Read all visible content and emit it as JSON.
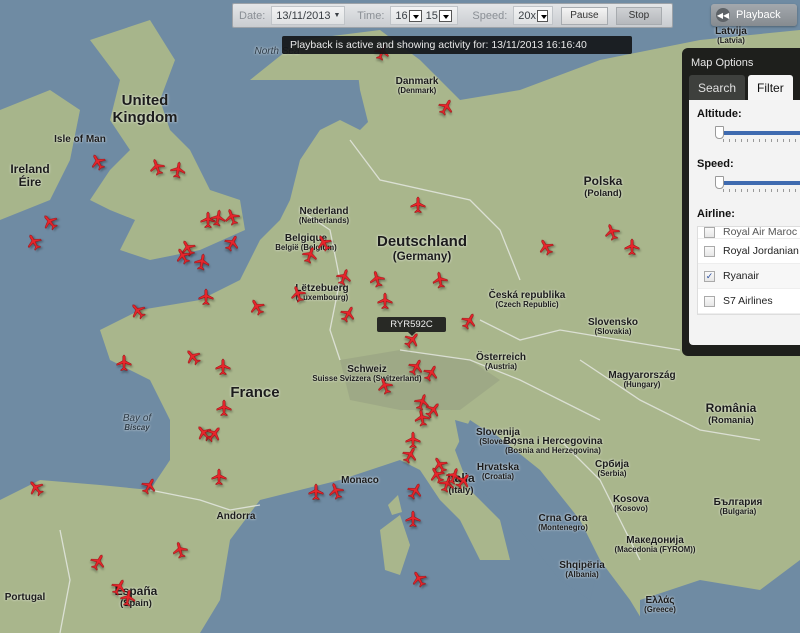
{
  "toolbar": {
    "date_label": "Date:",
    "date_value": "13/11/2013",
    "time_label": "Time:",
    "time_hour": "16",
    "time_minute": "15",
    "speed_label": "Speed:",
    "speed_value": "20x",
    "pause_label": "Pause",
    "stop_label": "Stop"
  },
  "status_message": "Playback is active and showing activity for: 13/11/2013 16:16:40",
  "playback_button": {
    "label": "Playback",
    "icon": "rewind-icon"
  },
  "map_options": {
    "title": "Map Options",
    "tabs": [
      {
        "label": "Search",
        "active": false
      },
      {
        "label": "Filter",
        "active": true
      }
    ],
    "altitude_label": "Altitude:",
    "altitude_value": 0,
    "speed_label": "Speed:",
    "speed_value": 0,
    "airline_label": "Airline:",
    "airlines": [
      {
        "name": "Royal Air Maroc",
        "checked": false
      },
      {
        "name": "Royal Jordanian",
        "checked": false
      },
      {
        "name": "Ryanair",
        "checked": true
      },
      {
        "name": "S7 Airlines",
        "checked": false
      }
    ]
  },
  "selected_flight": "RYR592C",
  "plane_color": "#e8262c",
  "map_labels": [
    {
      "name": "United",
      "sub": "Kingdom",
      "size": "lg",
      "sub_full": true
    },
    {
      "name": "Isle of Man",
      "size": "sm"
    },
    {
      "name": "Ireland",
      "sub": "Éire",
      "size": "md",
      "sub_full": true
    },
    {
      "name": "North Sea",
      "size": "sm",
      "sea": true
    },
    {
      "name": "Danmark",
      "sub": "(Denmark)",
      "size": "sm"
    },
    {
      "name": "Latvija",
      "sub": "(Latvia)",
      "size": "sm"
    },
    {
      "name": "Nederland",
      "sub": "(Netherlands)",
      "size": "sm"
    },
    {
      "name": "Belgique",
      "sub": "België (Belgium)",
      "size": "sm"
    },
    {
      "name": "Deutschland",
      "sub": "(Germany)",
      "size": "lg"
    },
    {
      "name": "Polska",
      "sub": "(Poland)",
      "size": "md"
    },
    {
      "name": "Lëtzebuerg",
      "sub": "(Luxembourg)",
      "size": "sm"
    },
    {
      "name": "Česká republika",
      "sub": "(Czech Republic)",
      "size": "sm"
    },
    {
      "name": "Slovensko",
      "sub": "(Slovakia)",
      "size": "sm"
    },
    {
      "name": "Österreich",
      "sub": "(Austria)",
      "size": "sm"
    },
    {
      "name": "Schweiz",
      "sub": "Suisse Svizzera (Switzerland)",
      "size": "sm"
    },
    {
      "name": "France",
      "size": "lg"
    },
    {
      "name": "Magyarország",
      "sub": "(Hungary)",
      "size": "sm"
    },
    {
      "name": "România",
      "sub": "(Romania)",
      "size": "md"
    },
    {
      "name": "Slovenija",
      "sub": "(Slovenia)",
      "size": "sm"
    },
    {
      "name": "Hrvatska",
      "sub": "(Croatia)",
      "size": "sm"
    },
    {
      "name": "Bosna i Hercegovina",
      "sub": "(Bosnia and Herzegovina)",
      "size": "sm"
    },
    {
      "name": "Србија",
      "sub": "(Serbia)",
      "size": "sm"
    },
    {
      "name": "Bay of",
      "sub": "Biscay",
      "size": "sm",
      "sea": true
    },
    {
      "name": "Monaco",
      "size": "sm"
    },
    {
      "name": "Andorra",
      "size": "sm"
    },
    {
      "name": "Italia",
      "sub": "(Italy)",
      "size": "md"
    },
    {
      "name": "Crna Gora",
      "sub": "(Montenegro)",
      "size": "sm"
    },
    {
      "name": "Kosova",
      "sub": "(Kosovo)",
      "size": "sm"
    },
    {
      "name": "Македонија",
      "sub": "(Macedonia (FYROM))",
      "size": "sm"
    },
    {
      "name": "България",
      "sub": "(Bulgaria)",
      "size": "sm"
    },
    {
      "name": "Shqipëria",
      "sub": "(Albania)",
      "size": "sm"
    },
    {
      "name": "Ελλάς",
      "sub": "(Greece)",
      "size": "sm"
    },
    {
      "name": "Portugal",
      "size": "sm"
    },
    {
      "name": "España",
      "sub": "(Spain)",
      "size": "md"
    }
  ]
}
